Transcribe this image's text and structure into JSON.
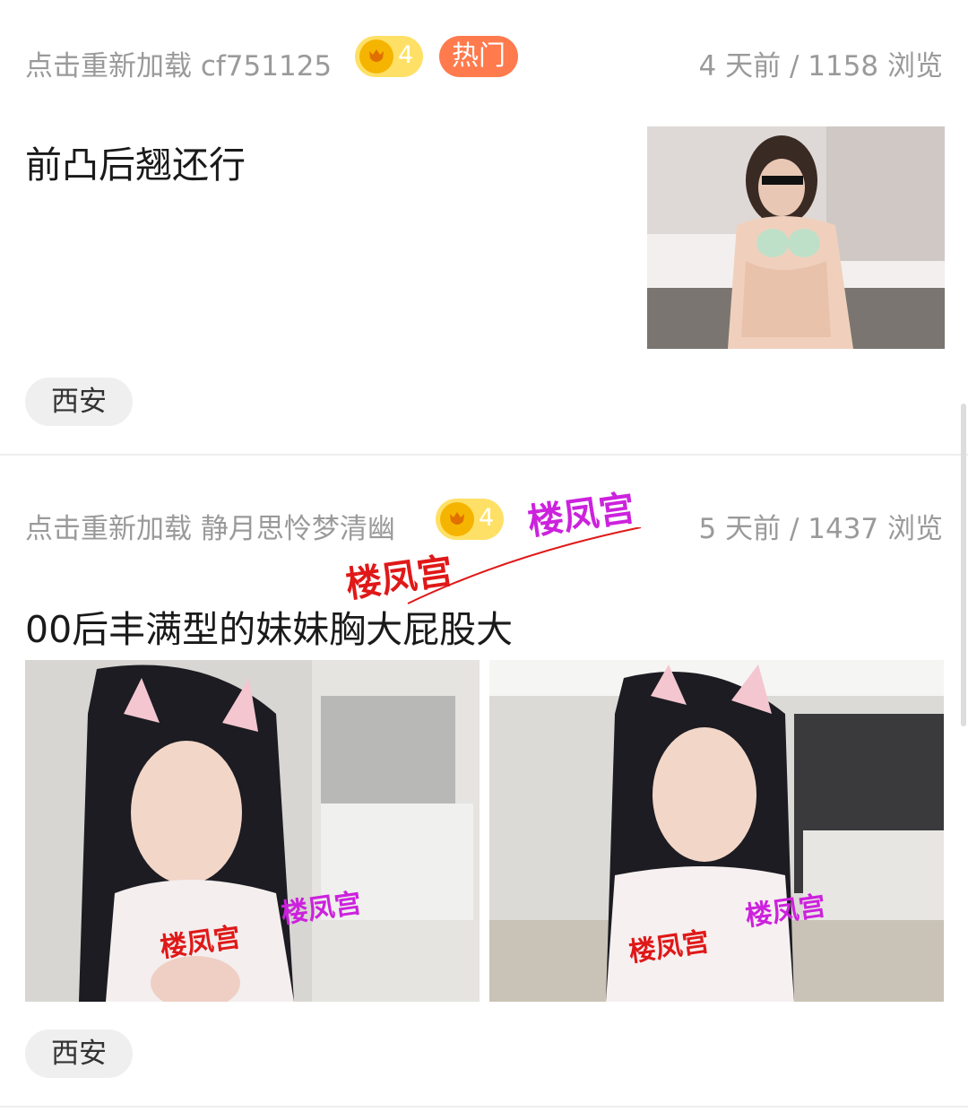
{
  "posts": [
    {
      "author": "点击重新加载  cf751125",
      "level": "4",
      "hot_label": "热门",
      "stats": "4 天前  /  1158 浏览",
      "title": "前凸后翘还行",
      "location": "西安"
    },
    {
      "author": "点击重新加载  静月思怜梦清幽",
      "level": "4",
      "stats": "5 天前  /  1437 浏览",
      "title": "00后丰满型的妹妹胸大屁股大",
      "location": "西安",
      "watermarks": [
        "楼凤宫",
        "楼凤宫",
        "楼凤宫",
        "楼凤宫",
        "楼凤宫",
        "楼凤宫"
      ]
    }
  ],
  "colors": {
    "meta_text": "#9a9a9a",
    "level_badge": "#ffe066",
    "hot_badge": "#ff7a4d",
    "tag_bg": "#efefef"
  },
  "icons": {
    "level": "tulip-coin-icon"
  }
}
